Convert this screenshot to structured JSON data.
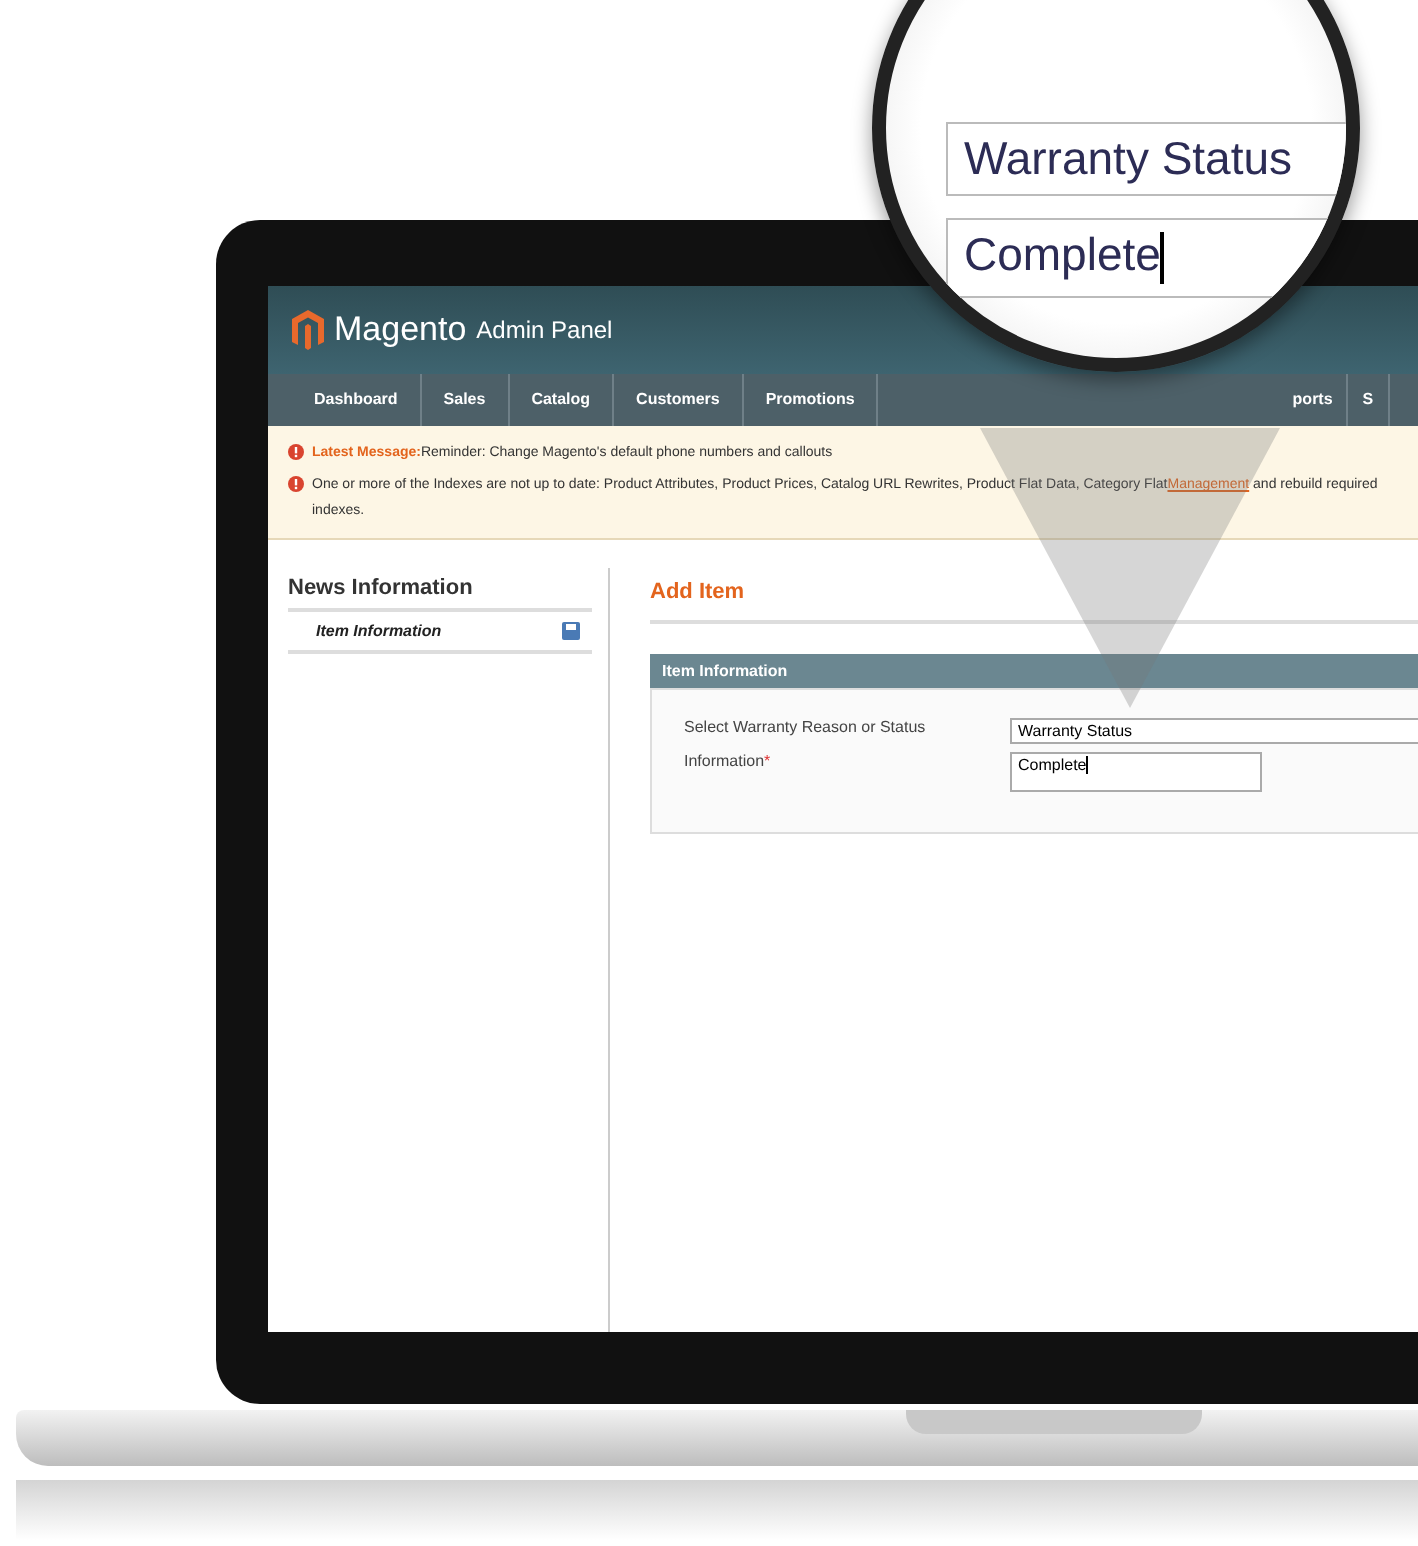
{
  "header": {
    "logo_name": "Magento",
    "logo_sub": "Admin Panel"
  },
  "nav": [
    {
      "label": "Dashboard"
    },
    {
      "label": "Sales"
    },
    {
      "label": "Catalog"
    },
    {
      "label": "Customers"
    },
    {
      "label": "Promotions"
    },
    {
      "label": "ports",
      "kind": "far"
    },
    {
      "label": "S",
      "kind": "far"
    }
  ],
  "messages": [
    {
      "lead": "Latest Message:",
      "text": "Reminder: Change Magento's default phone numbers and callouts"
    },
    {
      "text": "One or more of the Indexes are not up to date: Product Attributes, Product Prices, Catalog URL Rewrites, Product Flat Data, Category Flat",
      "link": "Management",
      "after": "and rebuild required indexes."
    }
  ],
  "sidebar": {
    "title": "News Information",
    "items": [
      {
        "label": "Item Information",
        "selected": true
      }
    ]
  },
  "main": {
    "title": "Add Item",
    "section": "Item Information",
    "fields": [
      {
        "label": "Select Warranty Reason or Status",
        "value": "Warranty Status"
      },
      {
        "label": "Information",
        "required_mark": "*",
        "value": "Complete"
      }
    ]
  },
  "magnifier": {
    "fields": [
      {
        "value": "Warranty Status"
      },
      {
        "value": "Complete"
      }
    ]
  }
}
